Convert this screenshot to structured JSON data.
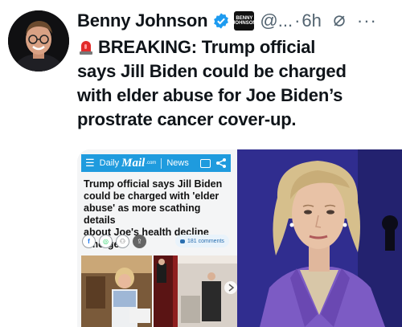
{
  "author": {
    "name": "Benny Johnson",
    "handle": "@...",
    "separator": "·",
    "time": "6h",
    "affiliate_badge": [
      "BENNY",
      "JOHNSON"
    ],
    "more": "···"
  },
  "tweet": {
    "line1": "BREAKING: Trump official",
    "line2": "says Jill Biden could be charged",
    "line3": "with elder abuse for Joe Biden’s",
    "line4": "prostrate cancer cover-up.",
    "icon": "rotating-light-icon"
  },
  "screenshot": {
    "brand_daily": "Daily",
    "brand_mail": "Mail",
    "brand_sub": ".com",
    "section": "News",
    "headline_lines": [
      "Trump official says Jill Biden",
      "could be charged with 'elder",
      "abuse' as more scathing details",
      "about Joe's health decline",
      "emerge"
    ],
    "share_icons": [
      "f",
      "◎",
      "⚇",
      "⇪"
    ],
    "comments": "181 comments"
  },
  "colors": {
    "verified": "#1d9bf0",
    "dailymail_blue": "#1f9bde",
    "secondary_text": "#536471",
    "purple_suit": "#7c5bc4"
  }
}
